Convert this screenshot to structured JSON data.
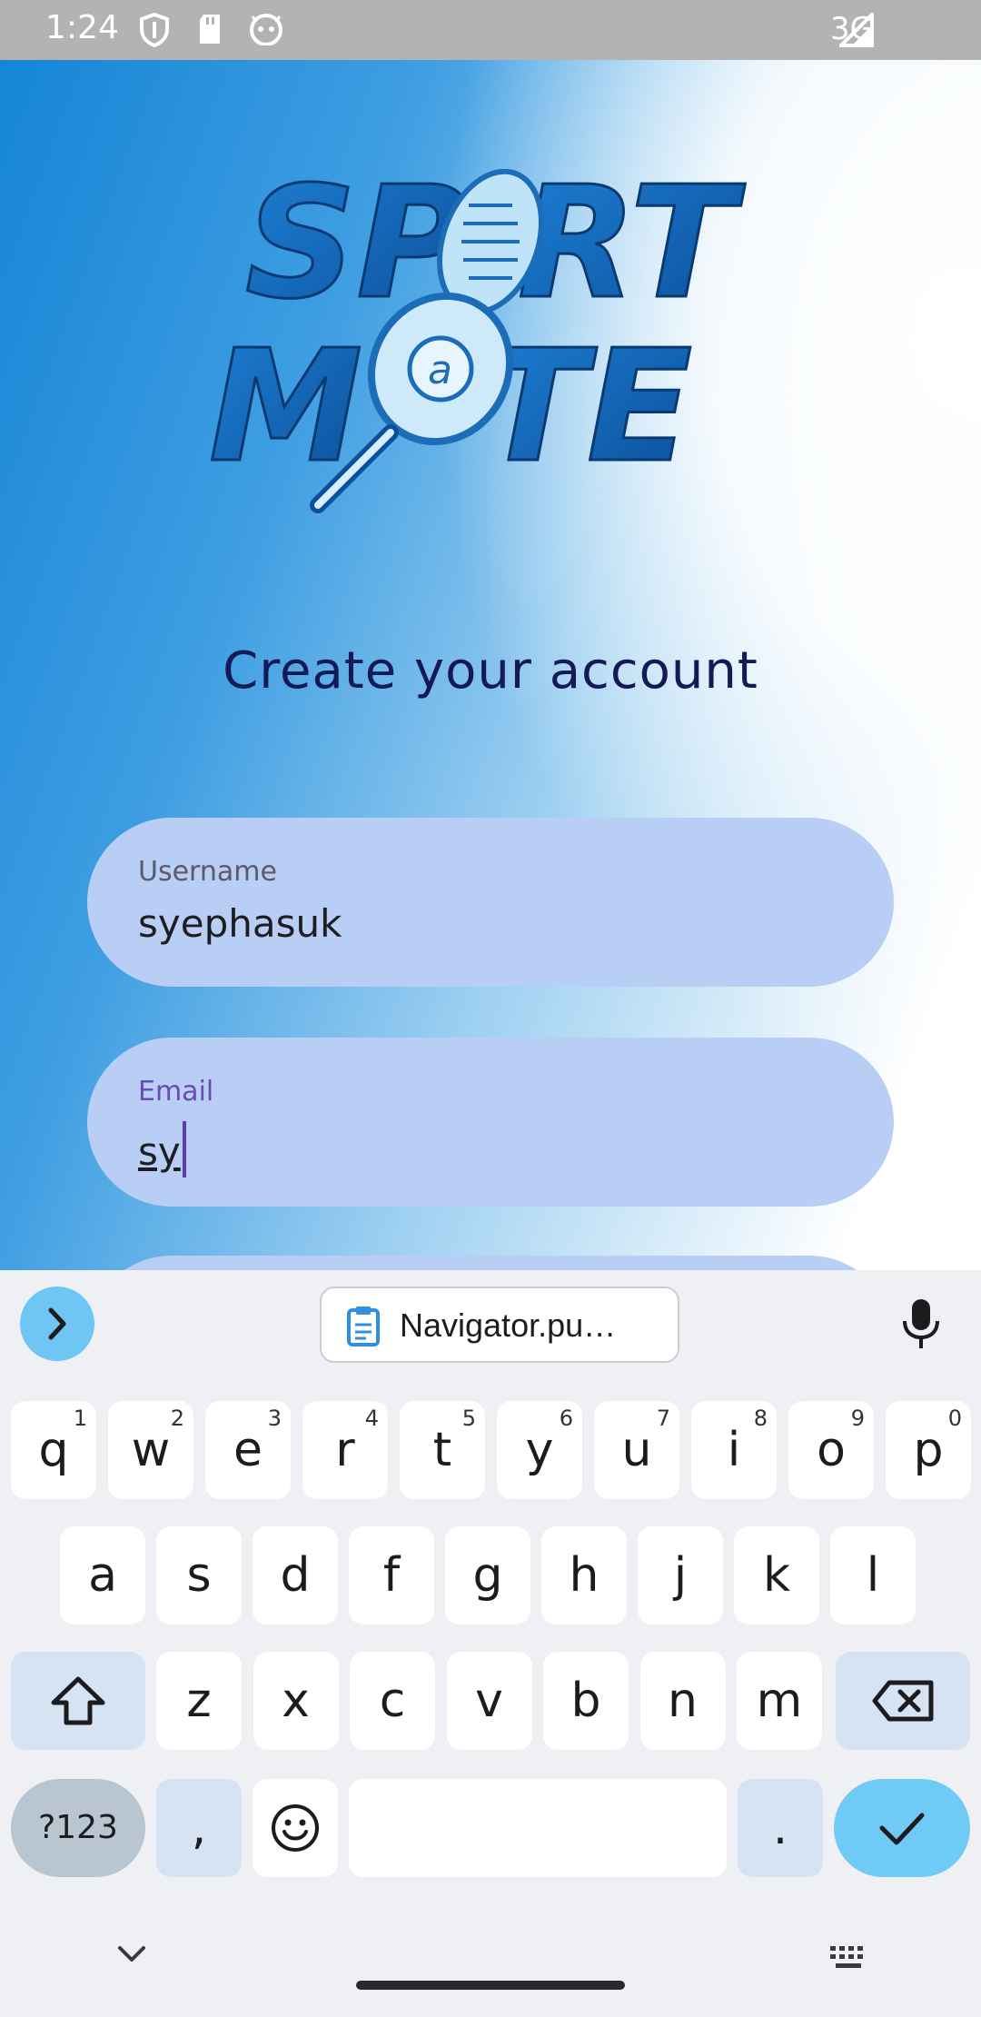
{
  "status_bar": {
    "time": "1:24",
    "network": "3G",
    "icons": [
      "shield-icon",
      "sd-card-icon",
      "android-icon",
      "signal-icon"
    ]
  },
  "app": {
    "logo_alt": "SPORT MATE",
    "heading": "Create your account",
    "fields": {
      "username": {
        "label": "Username",
        "value": "syephasuk"
      },
      "email": {
        "label": "Email",
        "value": "sy"
      }
    }
  },
  "keyboard": {
    "clipboard_chip": "Navigator.pu…",
    "row1": [
      {
        "k": "q",
        "n": "1"
      },
      {
        "k": "w",
        "n": "2"
      },
      {
        "k": "e",
        "n": "3"
      },
      {
        "k": "r",
        "n": "4"
      },
      {
        "k": "t",
        "n": "5"
      },
      {
        "k": "y",
        "n": "6"
      },
      {
        "k": "u",
        "n": "7"
      },
      {
        "k": "i",
        "n": "8"
      },
      {
        "k": "o",
        "n": "9"
      },
      {
        "k": "p",
        "n": "0"
      }
    ],
    "row2": [
      "a",
      "s",
      "d",
      "f",
      "g",
      "h",
      "j",
      "k",
      "l"
    ],
    "row3": [
      "z",
      "x",
      "c",
      "v",
      "b",
      "n",
      "m"
    ],
    "symbols_key": "?123",
    "comma_key": ",",
    "period_key": "."
  },
  "colors": {
    "accent": "#6fcaf6",
    "field_bg": "#b8cef4",
    "heading": "#131a55"
  }
}
